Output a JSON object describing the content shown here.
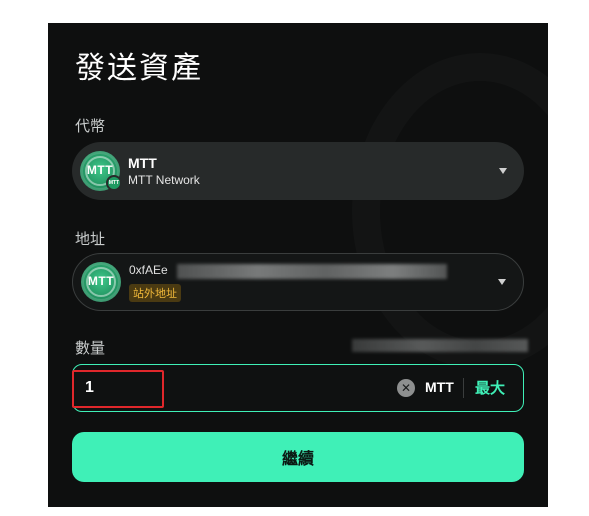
{
  "page": {
    "title": "發送資產"
  },
  "token": {
    "label": "代幣",
    "symbol": "MTT",
    "network": "MTT Network",
    "logo_text": "MTT",
    "badge_text": "MTT"
  },
  "address": {
    "label": "地址",
    "value_prefix": "0xfAEe",
    "tag": "站外地址",
    "logo_text": "MTT"
  },
  "amount": {
    "label": "數量",
    "value": "1",
    "unit": "MTT",
    "max_label": "最大",
    "clear_glyph": "✕"
  },
  "actions": {
    "continue_label": "繼續"
  },
  "colors": {
    "accent": "#3ff0b7",
    "panel_bg": "#0e0f0f",
    "warning_tag": "#f1b93a",
    "highlight": "#e0272b"
  }
}
